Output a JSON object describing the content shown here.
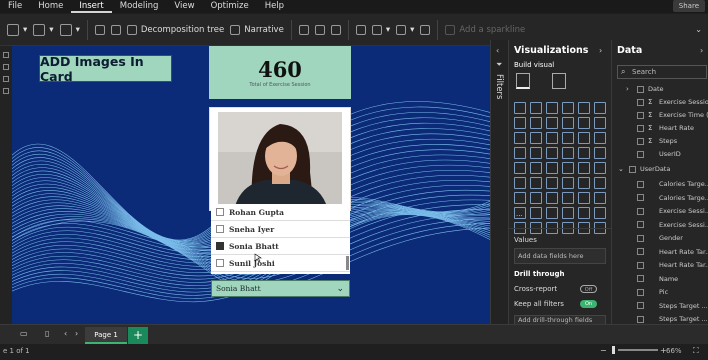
{
  "menu": {
    "items": [
      "File",
      "Home",
      "Insert",
      "Modeling",
      "View",
      "Optimize",
      "Help"
    ],
    "active": "Insert",
    "share_label": "Share"
  },
  "ribbon": {
    "decomposition_tree": "Decomposition tree",
    "narrative": "Narrative",
    "add_sparkline": "Add a sparkline"
  },
  "canvas": {
    "title_box": "ADD Images In Card",
    "card": {
      "value": "460",
      "label": "Total of Exercise Session"
    },
    "slicer_items": [
      {
        "name": "Rohan Gupta",
        "checked": false
      },
      {
        "name": "Sneha Iyer",
        "checked": false
      },
      {
        "name": "Sonia Bhatt",
        "checked": true
      },
      {
        "name": "Sunil Joshi",
        "checked": false
      }
    ],
    "dropdown_value": "Sonia Bhatt",
    "colors": {
      "background": "#0b2a78",
      "card": "#9fd6bd",
      "waves": "#8fd8ff"
    }
  },
  "filters_pane": {
    "label": "Filters"
  },
  "visualizations_pane": {
    "title": "Visualizations",
    "build_visual": "Build visual",
    "values_label": "Values",
    "values_placeholder": "Add data fields here",
    "drill_through": "Drill through",
    "cross_report": "Cross-report",
    "cross_report_state": "Off",
    "keep_all_filters": "Keep all filters",
    "keep_all_filters_state": "On",
    "drill_placeholder": "Add drill-through fields here"
  },
  "data_pane": {
    "title": "Data",
    "search_placeholder": "Search",
    "fields": [
      {
        "label": "Date",
        "kind": "table"
      },
      {
        "label": "Exercise Session",
        "kind": "sum"
      },
      {
        "label": "Exercise Time (...",
        "kind": "sum"
      },
      {
        "label": "Heart Rate",
        "kind": "sum"
      },
      {
        "label": "Steps",
        "kind": "sum"
      },
      {
        "label": "UserID",
        "kind": "field"
      }
    ],
    "table_name": "UserData",
    "userdata_fields": [
      "Calories Targe...",
      "Calories Targe...",
      "Exercise Sessi...",
      "Exercise Sessi...",
      "Gender",
      "Heart Rate Tar...",
      "Heart Rate Tar...",
      "Name",
      "Pic",
      "Steps Target ...",
      "Steps Target ...",
      "User ID"
    ]
  },
  "bottom": {
    "page_tab": "Page 1",
    "add_page": "+",
    "status": "e 1 of 1",
    "zoom": "66%"
  }
}
